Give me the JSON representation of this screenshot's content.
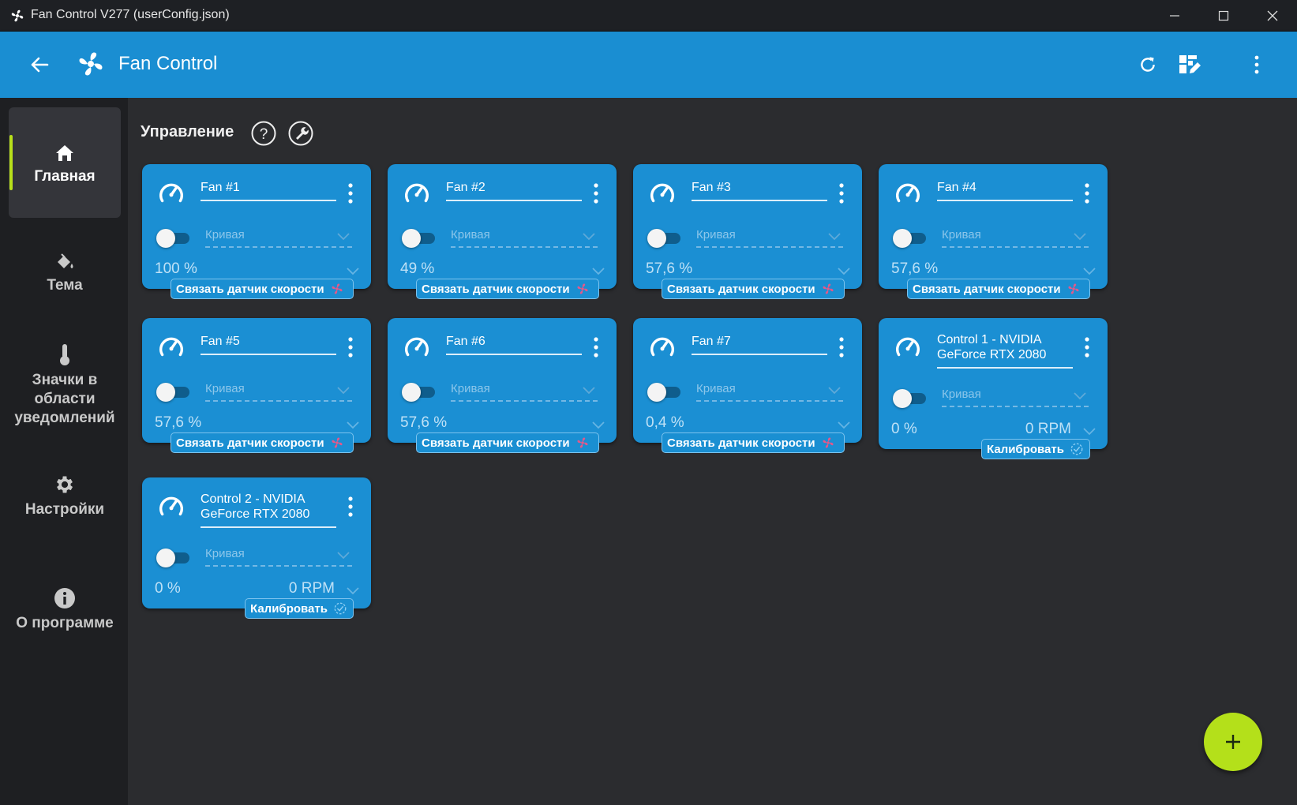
{
  "window": {
    "title": "Fan Control V277 (userConfig.json)",
    "icon": "fan-icon",
    "controls": [
      "minimize-icon",
      "maximize-icon",
      "close-icon"
    ]
  },
  "appbar": {
    "title": "Fan Control",
    "actions": [
      "refresh-icon",
      "layout-edit-icon",
      "more-vert-icon"
    ]
  },
  "sidebar": {
    "items": [
      {
        "label": "Главная",
        "icon": "home-icon",
        "active": true
      },
      {
        "label": "Тема",
        "icon": "paint-bucket-icon",
        "active": false
      },
      {
        "label": "Значки в области уведомлений",
        "icon": "thermometer-icon",
        "active": false
      },
      {
        "label": "Настройки",
        "icon": "gear-icon",
        "active": false
      },
      {
        "label": "О программе",
        "icon": "info-icon",
        "active": false
      }
    ]
  },
  "main": {
    "section_title": "Управление",
    "cards": [
      {
        "name": "Fan #1",
        "enabled": false,
        "curve_placeholder": "Кривая",
        "percent": "100 %",
        "rpm": "",
        "action": "Связать датчик скорости",
        "action_icon": "fan-pink-icon"
      },
      {
        "name": "Fan #2",
        "enabled": false,
        "curve_placeholder": "Кривая",
        "percent": "49 %",
        "rpm": "",
        "action": "Связать датчик скорости",
        "action_icon": "fan-pink-icon"
      },
      {
        "name": "Fan #3",
        "enabled": false,
        "curve_placeholder": "Кривая",
        "percent": "57,6 %",
        "rpm": "",
        "action": "Связать датчик скорости",
        "action_icon": "fan-pink-icon"
      },
      {
        "name": "Fan #4",
        "enabled": false,
        "curve_placeholder": "Кривая",
        "percent": "57,6 %",
        "rpm": "",
        "action": "Связать датчик скорости",
        "action_icon": "fan-pink-icon"
      },
      {
        "name": "Fan #5",
        "enabled": false,
        "curve_placeholder": "Кривая",
        "percent": "57,6 %",
        "rpm": "",
        "action": "Связать датчик скорости",
        "action_icon": "fan-pink-icon"
      },
      {
        "name": "Fan #6",
        "enabled": false,
        "curve_placeholder": "Кривая",
        "percent": "57,6 %",
        "rpm": "",
        "action": "Связать датчик скорости",
        "action_icon": "fan-pink-icon"
      },
      {
        "name": "Fan #7",
        "enabled": false,
        "curve_placeholder": "Кривая",
        "percent": "0,4 %",
        "rpm": "",
        "action": "Связать датчик скорости",
        "action_icon": "fan-pink-icon"
      },
      {
        "name": "Control 1 - NVIDIA GeForce RTX 2080",
        "enabled": false,
        "curve_placeholder": "Кривая",
        "percent": "0 %",
        "rpm": "0 RPM",
        "action": "Калибровать",
        "action_icon": "calibrate-icon"
      },
      {
        "name": "Control 2 - NVIDIA GeForce RTX 2080",
        "enabled": false,
        "curve_placeholder": "Кривая",
        "percent": "0 %",
        "rpm": "0 RPM",
        "action": "Калибровать",
        "action_icon": "calibrate-icon"
      }
    ]
  },
  "fab": {
    "icon": "plus-icon"
  },
  "colors": {
    "appbar": "#1a8ed2",
    "card": "#1b8fd3",
    "accent": "#b4e01a",
    "background": "#2b2c2f",
    "sidebar": "#1e1f22",
    "fan_icon_pink": "#e2598b"
  }
}
